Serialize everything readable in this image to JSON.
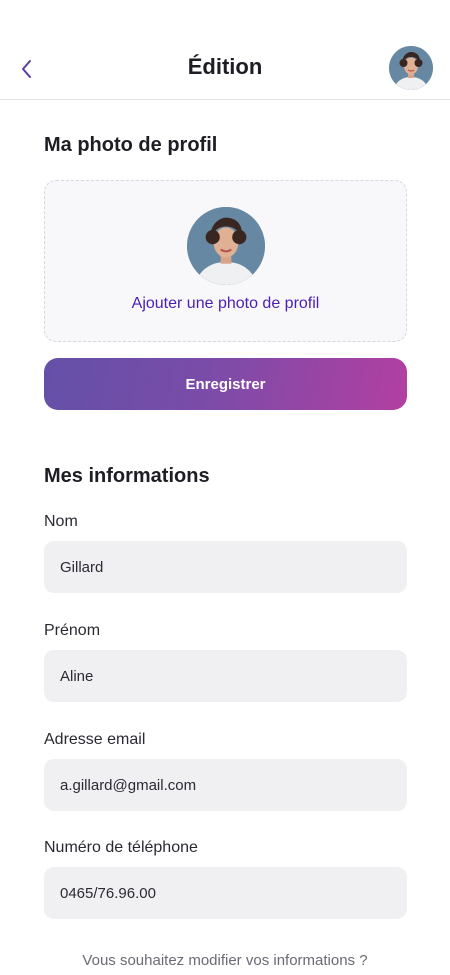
{
  "header": {
    "title": "Édition",
    "back_icon": "chevron-left-icon",
    "avatar": "profile-avatar"
  },
  "photo_section": {
    "title": "Ma photo de profil",
    "add_photo_label": "Ajouter une photo de profil"
  },
  "save_button_label": "Enregistrer",
  "info_section": {
    "title": "Mes informations",
    "fields": [
      {
        "label": "Nom",
        "value": "Gillard"
      },
      {
        "label": "Prénom",
        "value": "Aline"
      },
      {
        "label": "Adresse email",
        "value": "a.gillard@gmail.com"
      },
      {
        "label": "Numéro de téléphone",
        "value": "0465/76.96.00"
      }
    ]
  },
  "footer": {
    "text": "Vous souhaitez modifier vos informations ?"
  },
  "colors": {
    "accent": "#4c1fb4",
    "gradient_start": "#6450a8",
    "gradient_end": "#b23fa2",
    "input_bg": "#f0f0f3",
    "back_icon": "#5b3fa0"
  }
}
